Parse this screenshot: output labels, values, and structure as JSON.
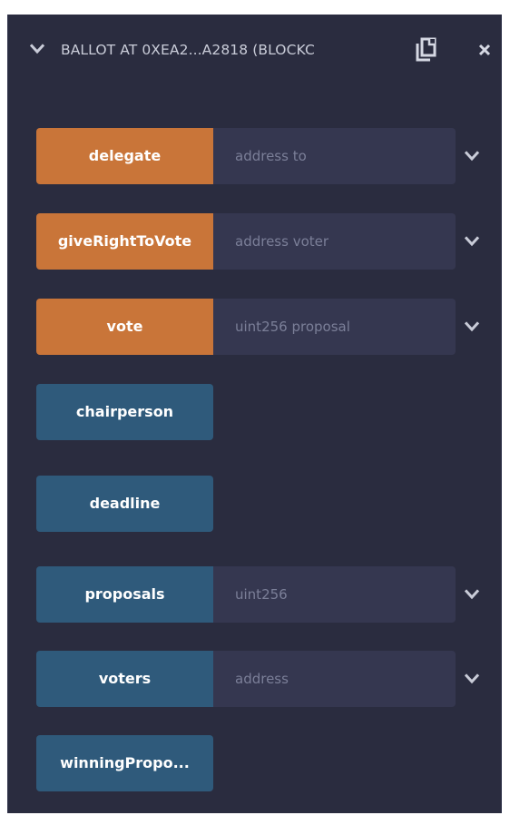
{
  "header": {
    "title": "BALLOT AT 0XEA2...A2818 (BLOCKC",
    "collapse_icon": "chevron-down-icon",
    "copy_icon": "copy-icon",
    "close_icon": "close-icon"
  },
  "colors": {
    "panel_bg": "#2a2c3f",
    "transact_button": "#c97539",
    "call_button": "#2f5a7b",
    "input_bg": "#353750",
    "title_text": "#c9ccd8",
    "placeholder_text": "#7b7f98"
  },
  "functions": [
    {
      "label": "delegate",
      "kind": "transact",
      "placeholder": "address to",
      "has_input": true
    },
    {
      "label": "giveRightToVote",
      "kind": "transact",
      "placeholder": "address voter",
      "has_input": true
    },
    {
      "label": "vote",
      "kind": "transact",
      "placeholder": "uint256 proposal",
      "has_input": true
    },
    {
      "label": "chairperson",
      "kind": "call",
      "has_input": false
    },
    {
      "label": "deadline",
      "kind": "call",
      "has_input": false
    },
    {
      "label": "proposals",
      "kind": "call",
      "placeholder": "uint256",
      "has_input": true
    },
    {
      "label": "voters",
      "kind": "call",
      "placeholder": "address",
      "has_input": true
    },
    {
      "label": "winningPropo...",
      "kind": "call",
      "has_input": false
    }
  ]
}
